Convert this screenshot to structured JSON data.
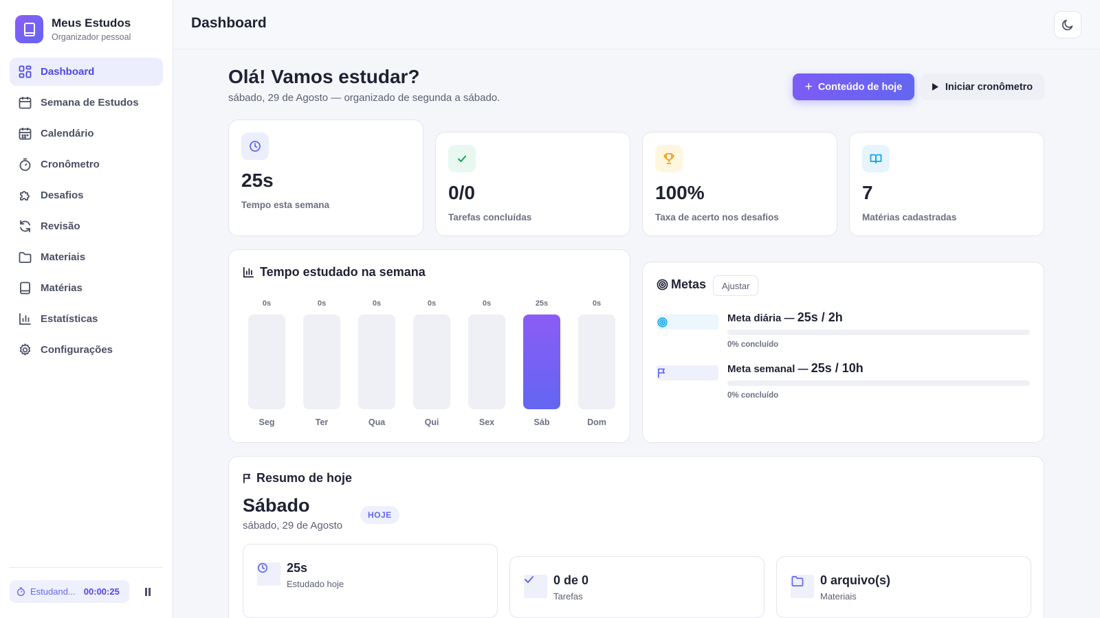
{
  "brand": {
    "title": "Meus Estudos",
    "subtitle": "Organizador pessoal"
  },
  "nav": [
    {
      "label": "Dashboard",
      "icon": "dashboard-icon",
      "active": true
    },
    {
      "label": "Semana de Estudos",
      "icon": "calendar-icon"
    },
    {
      "label": "Calendário",
      "icon": "calendar-days-icon"
    },
    {
      "label": "Cronômetro",
      "icon": "timer-icon"
    },
    {
      "label": "Desafios",
      "icon": "puzzle-icon"
    },
    {
      "label": "Revisão",
      "icon": "refresh-icon"
    },
    {
      "label": "Materiais",
      "icon": "folder-icon"
    },
    {
      "label": "Matérias",
      "icon": "book-icon"
    },
    {
      "label": "Estatísticas",
      "icon": "bar-chart-icon"
    },
    {
      "label": "Configurações",
      "icon": "gear-icon"
    }
  ],
  "sidebar_timer": {
    "label": "Estudand...",
    "time": "00:00:25"
  },
  "header": {
    "title": "Dashboard"
  },
  "hero": {
    "greeting": "Olá! Vamos estudar?",
    "subtitle": "sábado, 29 de Agosto — organizado de segunda a sábado.",
    "primary_button": "Conteúdo de hoje",
    "secondary_button": "Iniciar cronômetro"
  },
  "stats": [
    {
      "value": "25s",
      "label": "Tempo esta semana",
      "icon": "clock-icon"
    },
    {
      "value": "0/0",
      "label": "Tarefas concluídas",
      "icon": "check-icon"
    },
    {
      "value": "100%",
      "label": "Taxa de acerto nos desafios",
      "icon": "trophy-icon"
    },
    {
      "value": "7",
      "label": "Matérias cadastradas",
      "icon": "book-open-icon"
    }
  ],
  "week_chart": {
    "title": "Tempo estudado na semana",
    "accent": "#6366f1"
  },
  "chart_data": {
    "type": "bar",
    "categories": [
      "Seg",
      "Ter",
      "Qua",
      "Qui",
      "Sex",
      "Sáb",
      "Dom"
    ],
    "value_labels": [
      "0s",
      "0s",
      "0s",
      "0s",
      "0s",
      "25s",
      "0s"
    ],
    "values": [
      0,
      0,
      0,
      0,
      0,
      25,
      0
    ],
    "title": "Tempo estudado na semana"
  },
  "goals": {
    "title": "Metas",
    "adjust_button": "Ajustar",
    "items": [
      {
        "label": "Meta diária — ",
        "value": "25s / 2h",
        "percent_label": "0% concluído",
        "progress": 0,
        "icon": "target-icon"
      },
      {
        "label": "Meta semanal — ",
        "value": "25s / 10h",
        "percent_label": "0% concluído",
        "progress": 0,
        "icon": "flag-icon"
      }
    ]
  },
  "today": {
    "title": "Resumo de hoje",
    "day_name": "Sábado",
    "date": "sábado, 29 de Agosto",
    "badge": "HOJE",
    "cards": [
      {
        "value": "25s",
        "label": "Estudado hoje",
        "icon": "clock-icon"
      },
      {
        "value": "0 de 0",
        "label": "Tarefas",
        "icon": "check-icon"
      },
      {
        "value": "0 arquivo(s)",
        "label": "Materiais",
        "icon": "folder-icon"
      }
    ]
  }
}
